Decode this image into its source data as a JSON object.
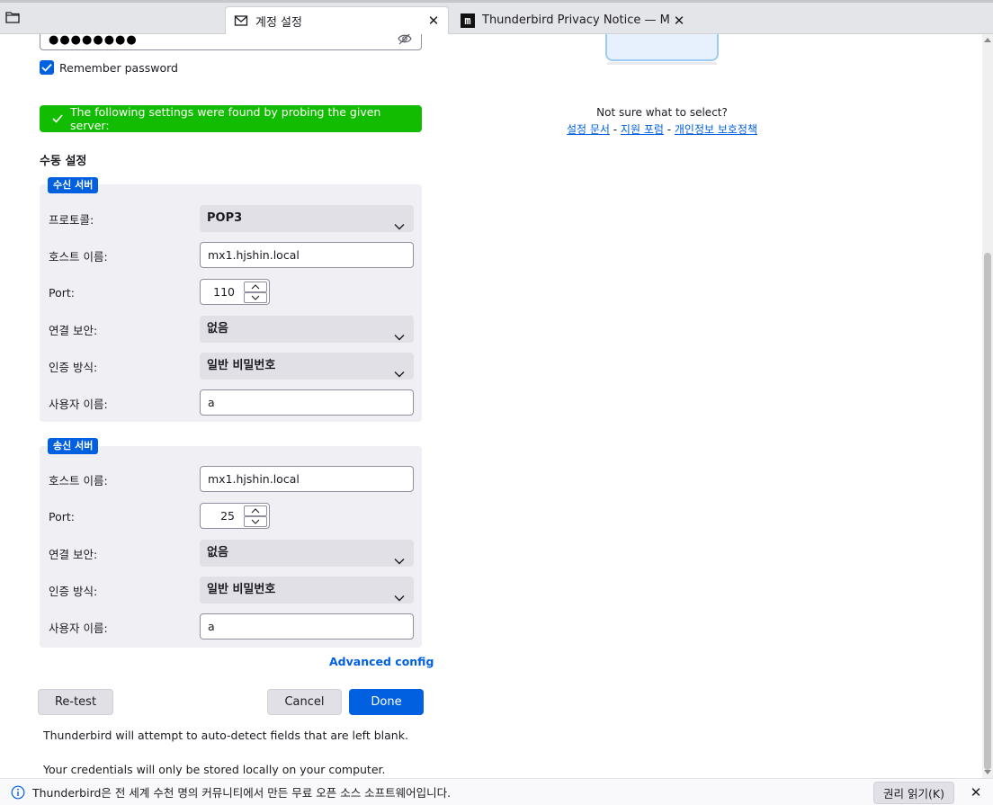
{
  "tabs": [
    {
      "label": "계정 설정",
      "icon": "mail-icon",
      "active": true
    },
    {
      "label": "Thunderbird Privacy Notice — Mo",
      "icon": "mozilla-m-icon",
      "active": false
    }
  ],
  "account": {
    "password_mask": "●●●●●●●●",
    "remember_label": "Remember password",
    "remember_checked": true
  },
  "banner": {
    "text": "The following settings were found by probing the given server:",
    "color": "#12bc00"
  },
  "manual": {
    "title": "수동 설정",
    "incoming": {
      "badge": "수신 서버",
      "protocol_label": "프로토콜:",
      "protocol_value": "POP3",
      "host_label": "호스트 이름:",
      "host_value": "mx1.hjshin.local",
      "port_label": "Port:",
      "port_value": "110",
      "security_label": "연결 보안:",
      "security_value": "없음",
      "auth_label": "인증 방식:",
      "auth_value": "일반 비밀번호",
      "username_label": "사용자 이름:",
      "username_value": "a"
    },
    "outgoing": {
      "badge": "송신 서버",
      "host_label": "호스트 이름:",
      "host_value": "mx1.hjshin.local",
      "port_label": "Port:",
      "port_value": "25",
      "security_label": "연결 보안:",
      "security_value": "없음",
      "auth_label": "인증 방식:",
      "auth_value": "일반 비밀번호",
      "username_label": "사용자 이름:",
      "username_value": "a"
    },
    "advanced_label": "Advanced config"
  },
  "buttons": {
    "retest": "Re-test",
    "cancel": "Cancel",
    "done": "Done"
  },
  "notes": {
    "autodetect": "Thunderbird will attempt to auto-detect fields that are left blank.",
    "credentials": "Your credentials will only be stored locally on your computer."
  },
  "help": {
    "question": "Not sure what to select?",
    "link_docs": "설정 문서",
    "link_forum": "지원 포럼",
    "link_privacy": "개인정보 보호정책",
    "separator": " - "
  },
  "notification": {
    "text": "Thunderbird은 전 세계 수천 명의 커뮤니티에서 만든 무료 오픈 소스 소프트웨어입니다.",
    "button": "권리 읽기(K)"
  },
  "colors": {
    "accent": "#0060df",
    "success": "#12bc00"
  }
}
